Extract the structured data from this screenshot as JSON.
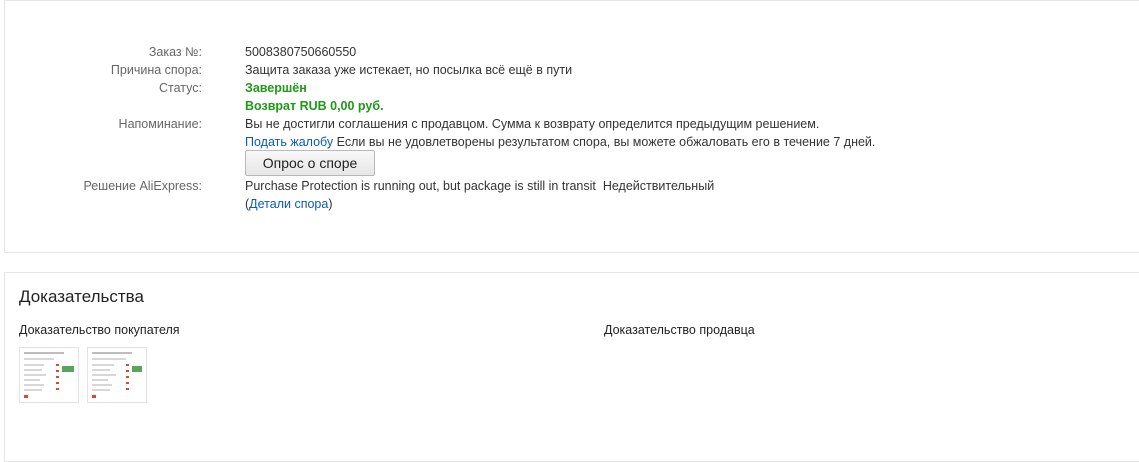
{
  "dispute": {
    "order_label": "Заказ №:",
    "order_value": "5008380750660550",
    "reason_label": "Причина спора:",
    "reason_value": "Защита заказа уже истекает, но посылка всё ещё в пути",
    "status_label": "Статус:",
    "status_value": "Завершён",
    "refund_value": "Возврат RUB 0,00 руб.",
    "reminder_label": "Напоминание:",
    "reminder_text": "Вы не достигли соглашения с продавцом. Сумма к возврату определится предыдущим решением.",
    "complaint_link": "Подать жалобу",
    "complaint_text": "Если вы не удовлетворены результатом спора, вы можете обжаловать его в течение 7 дней.",
    "survey_button": "Опрос о споре",
    "decision_label": "Решение AliExpress:",
    "decision_text": "Purchase Protection is running out, but package is still in transit",
    "decision_status": "Недействительный",
    "paren_open": "(",
    "details_link": "Детали спора",
    "paren_close": ")"
  },
  "evidence": {
    "title": "Доказательства",
    "buyer_label": "Доказательство покупателя",
    "seller_label": "Доказательство продавца",
    "buyer_thumbnails": [
      "thumbnail-1",
      "thumbnail-2"
    ]
  },
  "colors": {
    "status_green": "#1f9a17",
    "link_blue": "#0d5bb5",
    "label_gray": "#666666"
  }
}
